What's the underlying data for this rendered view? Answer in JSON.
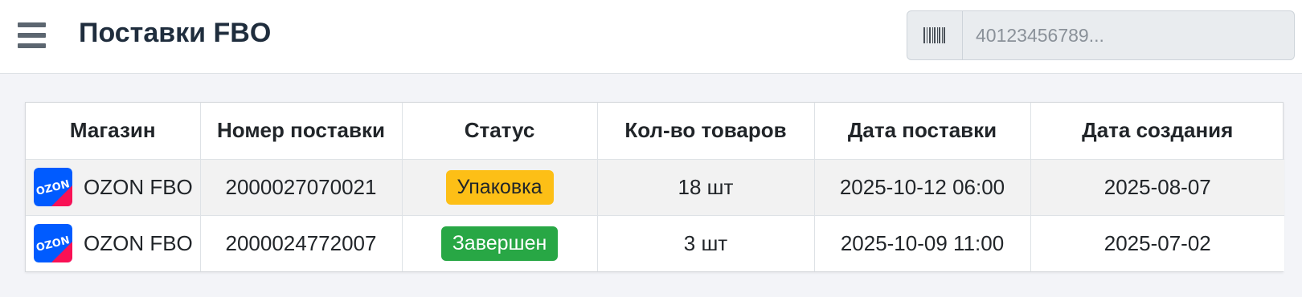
{
  "header": {
    "title": "Поставки FBO",
    "search_placeholder": "40123456789...",
    "search_value": ""
  },
  "table": {
    "columns": [
      "Магазин",
      "Номер поставки",
      "Статус",
      "Кол-во товаров",
      "Дата поставки",
      "Дата создания"
    ],
    "rows": [
      {
        "store": "OZON FBO",
        "store_logo_text": "OZON",
        "number": "2000027070021",
        "status": "Упаковка",
        "status_color": "#fdbf16",
        "quantity": "18 шт",
        "delivery_date": "2025-10-12 06:00",
        "created_date": "2025-08-07"
      },
      {
        "store": "OZON FBO",
        "store_logo_text": "OZON",
        "number": "2000024772007",
        "status": "Завершен",
        "status_color": "#28a745",
        "quantity": "3 шт",
        "delivery_date": "2025-10-09 11:00",
        "created_date": "2025-07-02"
      }
    ]
  },
  "colors": {
    "ozon_blue": "#005bff",
    "ozon_pink": "#f91155",
    "warning": "#fdbf16",
    "success": "#28a745"
  }
}
